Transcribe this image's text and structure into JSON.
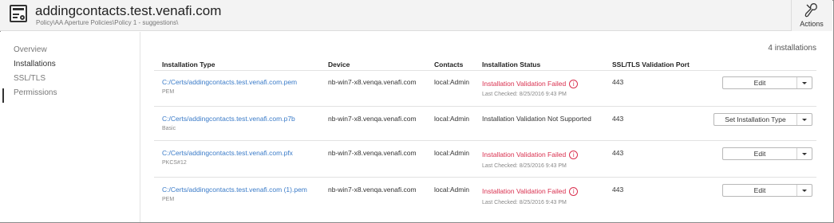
{
  "header": {
    "title": "addingcontacts.test.venafi.com",
    "breadcrumb": "Policy\\AA Aperture Policies\\Policy 1 - suggestions\\",
    "actions_label": "Actions"
  },
  "sidebar": {
    "items": [
      {
        "label": "Overview"
      },
      {
        "label": "Installations"
      },
      {
        "label": "SSL/TLS"
      },
      {
        "label": "Permissions"
      }
    ],
    "active": "Installations"
  },
  "main": {
    "count_text": "4 installations",
    "columns": [
      "Installation Type",
      "Device",
      "Contacts",
      "Installation Status",
      "SSL/TLS Validation Port"
    ],
    "rows": [
      {
        "path": "C:/Certs/addingcontacts.test.venafi.com.pem",
        "type": "PEM",
        "device": "nb-win7-x8.venqa.venafi.com",
        "contacts": "local:Admin",
        "status": "Installation Validation Failed",
        "last_checked": "Last Checked: 8/25/2016 9:43 PM",
        "port": "443",
        "action": "Edit"
      },
      {
        "path": "C:/Certs/addingcontacts.test.venafi.com.p7b",
        "type": "Basic",
        "device": "nb-win7-x8.venqa.venafi.com",
        "contacts": "local:Admin",
        "status": "Installation Validation Not Supported",
        "last_checked": "",
        "port": "443",
        "action": "Set Installation Type"
      },
      {
        "path": "C:/Certs/addingcontacts.test.venafi.com.pfx",
        "type": "PKCS#12",
        "device": "nb-win7-x8.venqa.venafi.com",
        "contacts": "local:Admin",
        "status": "Installation Validation Failed",
        "last_checked": "Last Checked: 8/25/2016 9:43 PM",
        "port": "443",
        "action": "Edit"
      },
      {
        "path": "C:/Certs/addingcontacts.test.venafi.com (1).pem",
        "type": "PEM",
        "device": "nb-win7-x8.venqa.venafi.com",
        "contacts": "local:Admin",
        "status": "Installation Validation Failed",
        "last_checked": "Last Checked: 8/25/2016 9:43 PM",
        "port": "443",
        "action": "Edit"
      }
    ]
  },
  "colors": {
    "link": "#3a7bc8",
    "error": "#d9304f",
    "header_bg": "#f3f3f3"
  },
  "icons": {
    "title": "certificate-icon",
    "actions": "wrench-icon",
    "status_failed": "info-circle-icon",
    "split_button": "chevron-down-icon"
  }
}
